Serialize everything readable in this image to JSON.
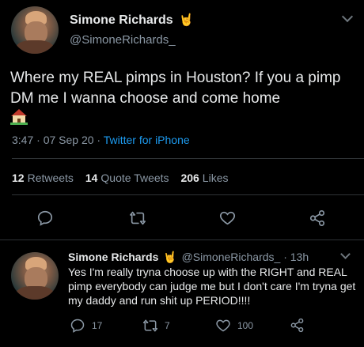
{
  "tweet": {
    "author_name": "Simone Richards",
    "author_emoji": "🤘",
    "handle": "@SimoneRichards_",
    "text": "Where my REAL pimps in Houston? If you a pimp DM me I wanna choose and come home",
    "time": "3:47 · 07 Sep 20 · ",
    "client": "Twitter for iPhone",
    "retweets": "12",
    "retweets_label": "Retweets",
    "quotes": "14",
    "quotes_label": "Quote Tweets",
    "likes": "206",
    "likes_label": "Likes"
  },
  "reply": {
    "author_name": "Simone Richards",
    "author_emoji": "🤘",
    "handle_time": "@SimoneRichards_ · 13h",
    "text": "Yes I'm really tryna choose up with the RIGHT and REAL pimp everybody can judge me but I don't care I'm tryna get my daddy and run shit up PERIOD!!!!",
    "replies": "17",
    "retweets": "7",
    "likes": "100"
  },
  "colors": {
    "background": "#000000",
    "text": "#e7e9ea",
    "muted": "#8b98a5",
    "link": "#1d9bf0",
    "divider": "#2f3336"
  }
}
